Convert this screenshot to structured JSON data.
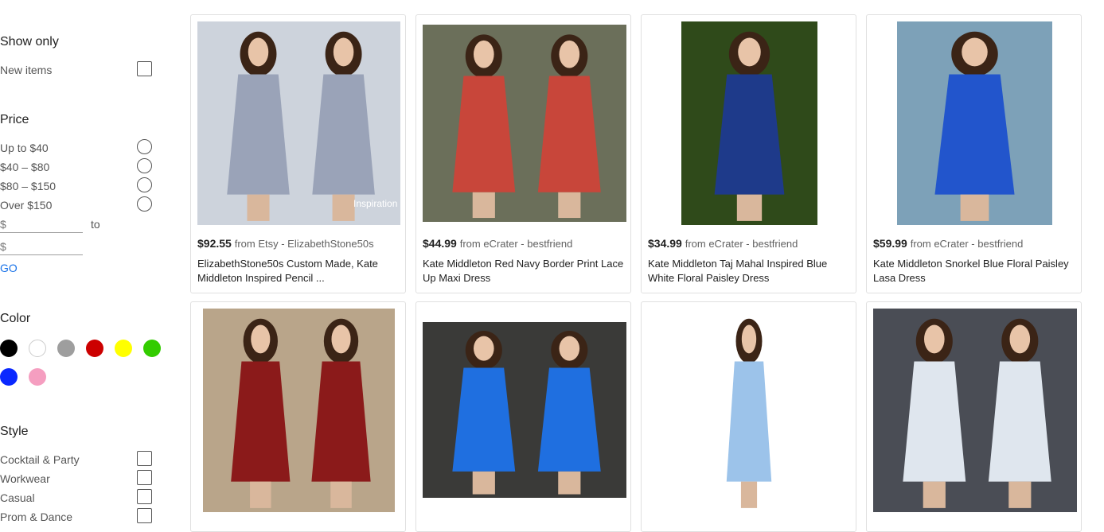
{
  "filters": {
    "show_only": {
      "title": "Show only",
      "options": [
        "New items"
      ]
    },
    "price": {
      "title": "Price",
      "options": [
        "Up to $40",
        "$40 – $80",
        "$80 – $150",
        "Over $150"
      ],
      "min_placeholder": "$",
      "max_placeholder": "$",
      "to_label": "to",
      "go_label": "GO"
    },
    "color": {
      "title": "Color",
      "swatches": [
        {
          "name": "black",
          "hex": "#000000"
        },
        {
          "name": "white",
          "hex": "#ffffff"
        },
        {
          "name": "gray",
          "hex": "#9e9e9e"
        },
        {
          "name": "red",
          "hex": "#cc0000"
        },
        {
          "name": "yellow",
          "hex": "#ffff00"
        },
        {
          "name": "green",
          "hex": "#33cc00"
        },
        {
          "name": "blue",
          "hex": "#0a28ff"
        },
        {
          "name": "pink",
          "hex": "#f59ec0"
        }
      ]
    },
    "style": {
      "title": "Style",
      "options": [
        "Cocktail & Party",
        "Workwear",
        "Casual",
        "Prom & Dance"
      ]
    }
  },
  "products": [
    {
      "price": "$92.55",
      "source": "from Etsy - ElizabethStone50s",
      "title": "ElizabethStone50s Custom Made, Kate Middleton Inspired Pencil ...",
      "overlay": "Inspiration",
      "dress_color": "#9aa3b8"
    },
    {
      "price": "$44.99",
      "source": "from eCrater - bestfriend",
      "title": "Kate Middleton Red Navy Border Print Lace Up Maxi Dress",
      "dress_color": "#c8463a"
    },
    {
      "price": "$34.99",
      "source": "from eCrater - bestfriend",
      "title": "Kate Middleton Taj Mahal Inspired Blue White Floral Paisley Dress",
      "dress_color": "#1e3a8a"
    },
    {
      "price": "$59.99",
      "source": "from eCrater - bestfriend",
      "title": "Kate Middleton Snorkel Blue Floral Paisley Lasa Dress",
      "dress_color": "#2255cc"
    },
    {
      "dress_color": "#8b1a1a"
    },
    {
      "dress_color": "#1f6fe0"
    },
    {
      "dress_color": "#9cc3ea"
    },
    {
      "dress_color": "#dfe6ee"
    }
  ],
  "colors": {
    "link": "#1a73e8",
    "card_border": "#e0e0e0"
  }
}
